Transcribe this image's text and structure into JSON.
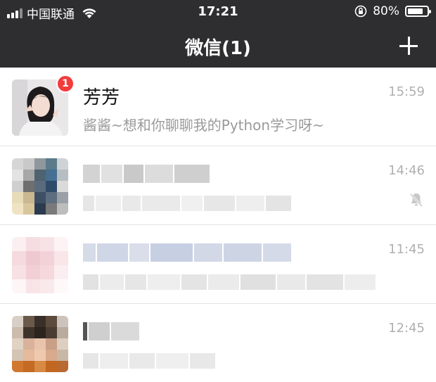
{
  "status_bar": {
    "carrier": "中国联通",
    "time": "17:21",
    "battery": "80%",
    "battery_level": 0.8
  },
  "nav": {
    "title": "微信(1)",
    "add_icon": "plus-icon"
  },
  "chats": [
    {
      "name": "芳芳",
      "preview": "酱酱~想和你聊聊我的Python学习呀~",
      "time": "15:59",
      "unread": "1"
    },
    {
      "time": "14:46",
      "muted": true
    },
    {
      "time": "11:45"
    },
    {
      "time": "12:45"
    }
  ],
  "colors": {
    "header_bg": "#2e2e30",
    "badge": "#f33b3b",
    "preview_text": "#9a9a9a",
    "time_text": "#b0b0b0"
  }
}
